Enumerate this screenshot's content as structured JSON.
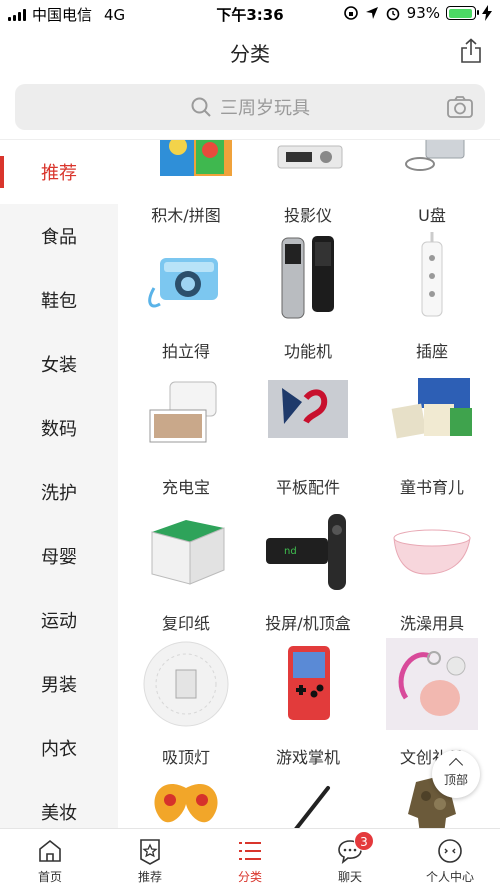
{
  "status_bar": {
    "carrier": "中国电信",
    "network": "4G",
    "time": "下午3:36",
    "battery": "93%"
  },
  "header": {
    "title": "分类"
  },
  "search": {
    "placeholder": "三周岁玩具"
  },
  "sidebar": {
    "items": [
      {
        "label": "推荐",
        "active": true
      },
      {
        "label": "食品"
      },
      {
        "label": "鞋包"
      },
      {
        "label": "女装"
      },
      {
        "label": "数码"
      },
      {
        "label": "洗护"
      },
      {
        "label": "母婴"
      },
      {
        "label": "运动"
      },
      {
        "label": "男装"
      },
      {
        "label": "内衣"
      },
      {
        "label": "美妆"
      }
    ]
  },
  "products": [
    {
      "label": "积木/拼图",
      "icon": "puzzle-icon"
    },
    {
      "label": "投影仪",
      "icon": "projector-icon"
    },
    {
      "label": "U盘",
      "icon": "usb-drive-icon"
    },
    {
      "label": "拍立得",
      "icon": "camera-icon"
    },
    {
      "label": "功能机",
      "icon": "feature-phone-icon"
    },
    {
      "label": "插座",
      "icon": "power-strip-icon"
    },
    {
      "label": "充电宝",
      "icon": "photo-printer-icon"
    },
    {
      "label": "平板配件",
      "icon": "tablet-case-icon"
    },
    {
      "label": "童书育儿",
      "icon": "books-icon"
    },
    {
      "label": "复印纸",
      "icon": "paper-box-icon"
    },
    {
      "label": "投屏/机顶盒",
      "icon": "tv-box-icon"
    },
    {
      "label": "洗澡用具",
      "icon": "bathtub-icon"
    },
    {
      "label": "吸顶灯",
      "icon": "ceiling-lamp-icon"
    },
    {
      "label": "游戏掌机",
      "icon": "game-console-icon"
    },
    {
      "label": "文创礼品",
      "icon": "keychain-icon"
    },
    {
      "label": "",
      "icon": "butterfly-kite-icon"
    },
    {
      "label": "",
      "icon": "pen-icon"
    },
    {
      "label": "",
      "icon": "jacket-icon"
    }
  ],
  "back_to_top": {
    "label": "顶部"
  },
  "tab_bar": {
    "items": [
      {
        "label": "首页",
        "icon": "home-icon"
      },
      {
        "label": "推荐",
        "icon": "star-tag-icon"
      },
      {
        "label": "分类",
        "icon": "category-list-icon",
        "active": true
      },
      {
        "label": "聊天",
        "icon": "chat-icon",
        "badge": "3"
      },
      {
        "label": "个人中心",
        "icon": "profile-icon"
      }
    ]
  },
  "colors": {
    "accent": "#d9352c",
    "badge": "#e4393c",
    "battery": "#4cd964"
  }
}
